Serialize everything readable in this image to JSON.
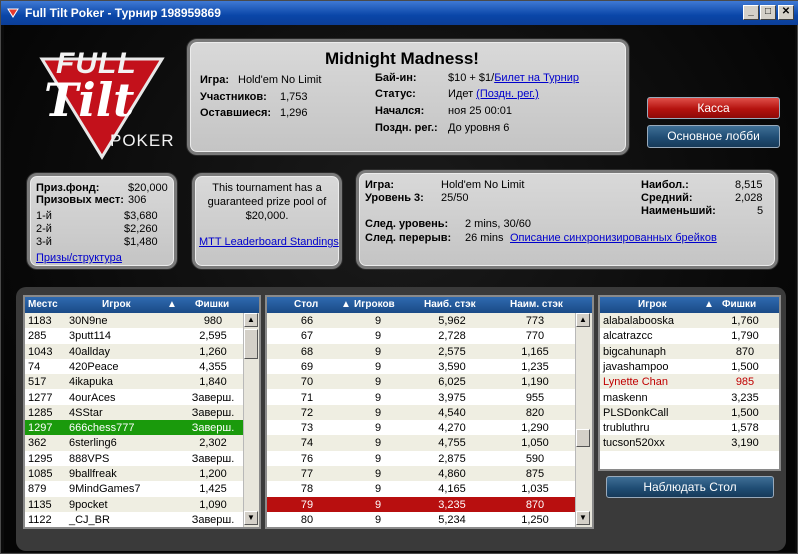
{
  "window": {
    "title": "Full Tilt Poker - Турнир 198959869"
  },
  "logo": {
    "line1": "FULL",
    "line2": "Tilt",
    "line3": "POKER"
  },
  "info": {
    "name": "Midnight Madness!",
    "game_label": "Игра:",
    "game_value": "Hold'em No Limit",
    "players_label": "Участников:",
    "players_value": "1,753",
    "remaining_label": "Оставшиеся:",
    "remaining_value": "1,296",
    "buyin_label": "Бай-ин:",
    "buyin_value": "$10 + $1/",
    "buyin_link": "Билет на Турнир",
    "status_label": "Статус:",
    "status_value": "Идет ",
    "status_link": "(Поздн. рег.)",
    "started_label": "Начался:",
    "started_value": "ноя 25 00:01",
    "late_label": "Поздн. рег.:",
    "late_value": "До уровня 6"
  },
  "buttons": {
    "cashier": "Касса",
    "main_lobby": "Основное лобби",
    "watch_table": "Наблюдать Стол"
  },
  "prize": {
    "pool_label": "Приз.фонд:",
    "pool_value": "$20,000",
    "places_label": "Призовых мест:",
    "places_value": "306",
    "p1_label": "1-й",
    "p1_value": "$3,680",
    "p2_label": "2-й",
    "p2_value": "$2,260",
    "p3_label": "3-й",
    "p3_value": "$1,480",
    "link": "Призы/структура"
  },
  "guarantee": {
    "text1": "This tournament has a",
    "text2": "guaranteed prize pool of",
    "text3": "$20,000.",
    "link": "MTT Leaderboard Standings"
  },
  "level": {
    "game_label": "Игра:",
    "game_value": "Hold'em No Limit",
    "level_label": "Уровень 3:",
    "level_value": "25/50",
    "next_level_label": "След. уровень:",
    "next_level_value": "2 mins, 30/60",
    "next_break_label": "След. перерыв:",
    "next_break_value": "26 mins",
    "break_link": "Описание синхронизированных брейков",
    "max_label": "Наибол.:",
    "max_value": "8,515",
    "avg_label": "Средний:",
    "avg_value": "2,028",
    "min_label": "Наименьший:",
    "min_value": "5"
  },
  "players": {
    "headers": [
      "Местс",
      "Игрок",
      "▲",
      "Фишки"
    ],
    "rows": [
      [
        "1183",
        "30N9ne",
        "980"
      ],
      [
        "285",
        "3putt114",
        "2,595"
      ],
      [
        "1043",
        "40allday",
        "1,260"
      ],
      [
        "74",
        "420Peace",
        "4,355"
      ],
      [
        "517",
        "4ikapuka",
        "1,840"
      ],
      [
        "1277",
        "4ourAces",
        "Заверш."
      ],
      [
        "1285",
        "4SStar",
        "Заверш."
      ],
      [
        "1297",
        "666chess777",
        "Заверш."
      ],
      [
        "362",
        "6sterling6",
        "2,302"
      ],
      [
        "1295",
        "888VPS",
        "Заверш."
      ],
      [
        "1085",
        "9ballfreak",
        "1,200"
      ],
      [
        "879",
        "9MindGames7",
        "1,425"
      ],
      [
        "1135",
        "9pocket",
        "1,090"
      ],
      [
        "1122",
        "_CJ_BR",
        "Заверш."
      ]
    ],
    "selected_row": 7
  },
  "tables": {
    "headers": [
      "Стол",
      "▲",
      "Игроков",
      "Наиб. стэк",
      "Наим. стэк"
    ],
    "rows": [
      [
        "66",
        "9",
        "5,962",
        "773"
      ],
      [
        "67",
        "9",
        "2,728",
        "770"
      ],
      [
        "68",
        "9",
        "2,575",
        "1,165"
      ],
      [
        "69",
        "9",
        "3,590",
        "1,235"
      ],
      [
        "70",
        "9",
        "6,025",
        "1,190"
      ],
      [
        "71",
        "9",
        "3,975",
        "955"
      ],
      [
        "72",
        "9",
        "4,540",
        "820"
      ],
      [
        "73",
        "9",
        "4,270",
        "1,290"
      ],
      [
        "74",
        "9",
        "4,755",
        "1,050"
      ],
      [
        "76",
        "9",
        "2,875",
        "590"
      ],
      [
        "77",
        "9",
        "4,860",
        "875"
      ],
      [
        "78",
        "9",
        "4,165",
        "1,035"
      ],
      [
        "79",
        "9",
        "3,235",
        "870"
      ],
      [
        "80",
        "9",
        "5,234",
        "1,250"
      ]
    ],
    "selected_row": 12
  },
  "seated": {
    "headers": [
      "Игрок",
      "▲",
      "Фишки"
    ],
    "rows": [
      [
        "alabalabooska",
        "1,760"
      ],
      [
        "alcatrazcc",
        "1,790"
      ],
      [
        "bigcahunaph",
        "870"
      ],
      [
        "javashampoo",
        "1,500"
      ],
      [
        "Lynette Chan",
        "985"
      ],
      [
        "maskenn",
        "3,235"
      ],
      [
        "PLSDonkCall",
        "1,500"
      ],
      [
        "trubluthru",
        "1,578"
      ],
      [
        "tucson520xx",
        "3,190"
      ]
    ],
    "highlight_row": 4,
    "highlight_color": "#c00000"
  },
  "colors": {
    "selected_green": "#1a9a0c",
    "selected_red": "#b80f0f",
    "header_blue": "#1f5596"
  }
}
